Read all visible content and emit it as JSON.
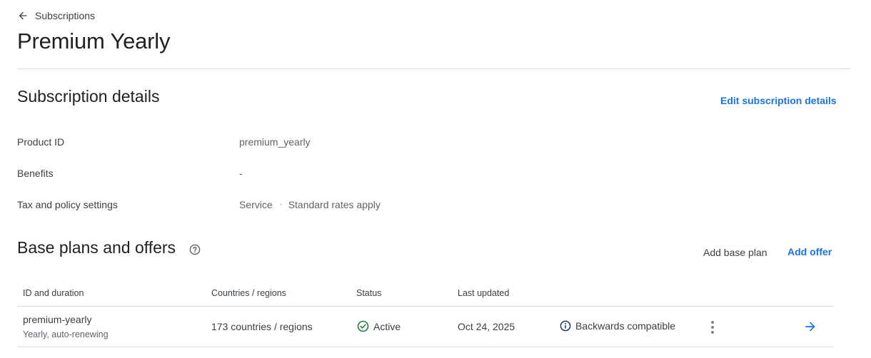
{
  "breadcrumb": {
    "back_icon": "arrow-left-icon",
    "label": "Subscriptions"
  },
  "page_title": "Premium Yearly",
  "details": {
    "heading": "Subscription details",
    "edit_link": "Edit subscription details",
    "rows": [
      {
        "label": "Product ID",
        "value": "premium_yearly"
      },
      {
        "label": "Benefits",
        "value": "-"
      },
      {
        "label": "Tax and policy settings",
        "value_parts": [
          "Service",
          "Standard rates apply"
        ]
      }
    ]
  },
  "plans": {
    "heading": "Base plans and offers",
    "help_icon": "help-circle-icon",
    "add_base_plan": "Add base plan",
    "add_offer": "Add offer",
    "columns": [
      "ID and duration",
      "Countries / regions",
      "Status",
      "Last updated"
    ],
    "rows": [
      {
        "id": "premium-yearly",
        "duration": "Yearly, auto-renewing",
        "countries": "173 countries / regions",
        "status": "Active",
        "status_icon": "check-circle-icon",
        "last_updated": "Oct 24, 2025",
        "compat_icon": "info-icon",
        "compat": "Backwards compatible",
        "menu_icon": "more-vert-icon",
        "open_icon": "arrow-right-icon"
      }
    ]
  },
  "colors": {
    "accent": "#1a73e8",
    "success": "#188038",
    "divider": "#dadce0",
    "text": "#202124",
    "secondary": "#5f6368"
  }
}
